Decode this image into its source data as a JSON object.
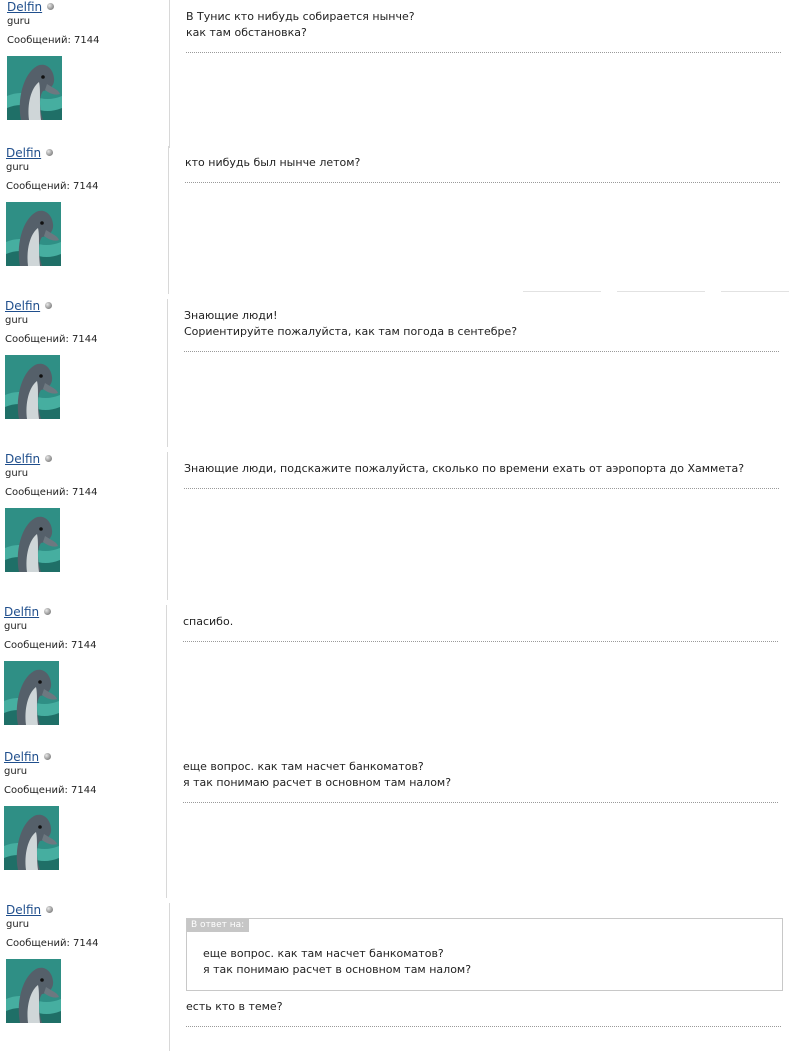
{
  "posts": [
    {
      "author": "Delfin",
      "rank": "guru",
      "count_label": "Сообщений: 7144",
      "lines": [
        "В Тунис кто нибудь собирается нынче?",
        "как там обстановка?"
      ]
    },
    {
      "author": "Delfin",
      "rank": "guru",
      "count_label": "Сообщений: 7144",
      "lines": [
        "кто нибудь был нынче летом?"
      ]
    },
    {
      "author": "Delfin",
      "rank": "guru",
      "count_label": "Сообщений: 7144",
      "lines": [
        "Знающие люди!",
        "Сориентируйте пожалуйста, как там погода в сентебре?"
      ]
    },
    {
      "author": "Delfin",
      "rank": "guru",
      "count_label": "Сообщений: 7144",
      "lines": [
        "Знающие люди, подскажите пожалуйста, сколько по времени ехать от аэропорта до Хаммета?"
      ]
    },
    {
      "author": "Delfin",
      "rank": "guru",
      "count_label": "Сообщений: 7144",
      "lines": [
        "спасибо."
      ]
    },
    {
      "author": "Delfin",
      "rank": "guru",
      "count_label": "Сообщений: 7144",
      "lines": [
        "еще вопрос. как там насчет банкоматов?",
        "я так понимаю расчет в основном там налом?"
      ]
    },
    {
      "author": "Delfin",
      "rank": "guru",
      "count_label": "Сообщений: 7144",
      "quote": {
        "label": "В ответ на:",
        "lines": [
          "еще вопрос. как там насчет банкоматов?",
          "я так понимаю расчет в основном там налом?"
        ]
      },
      "lines": [
        "есть кто в теме?"
      ]
    }
  ]
}
